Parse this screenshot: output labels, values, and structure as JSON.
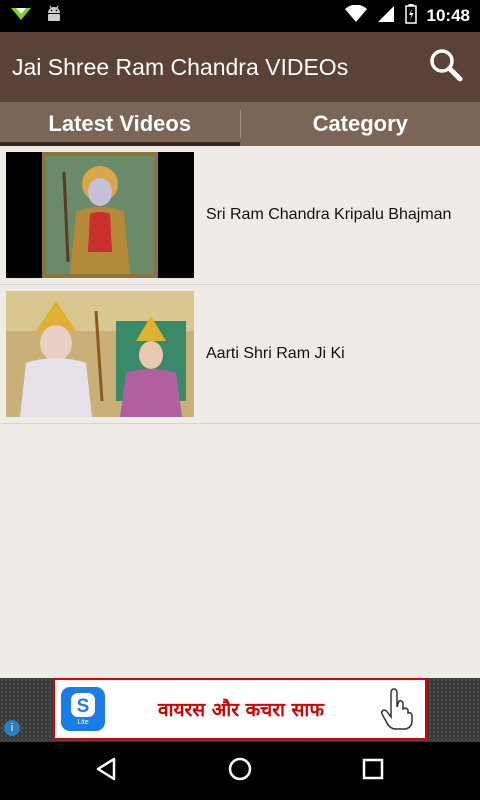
{
  "status_bar": {
    "time": "10:48",
    "icons": [
      "download-icon",
      "android-icon",
      "wifi-icon",
      "signal-icon",
      "battery-icon"
    ]
  },
  "app_bar": {
    "title": "Jai Shree Ram Chandra VIDEOs",
    "search_icon": "search-icon",
    "background": "#5a4238"
  },
  "tabs": [
    {
      "label": "Latest Videos",
      "active": true
    },
    {
      "label": "Category",
      "active": false
    }
  ],
  "videos": [
    {
      "title": "Sri Ram Chandra Kripalu Bhajman"
    },
    {
      "title": "Aarti Shri Ram Ji Ki"
    }
  ],
  "ad": {
    "text": "वायरस और कचरा साफ",
    "app_icon": "app-s-icon",
    "app_icon_label": "Lite",
    "info_icon": "info-icon",
    "accent": "#d40000"
  },
  "nav_bar": {
    "icons": [
      "back-icon",
      "home-icon",
      "recents-icon"
    ]
  }
}
